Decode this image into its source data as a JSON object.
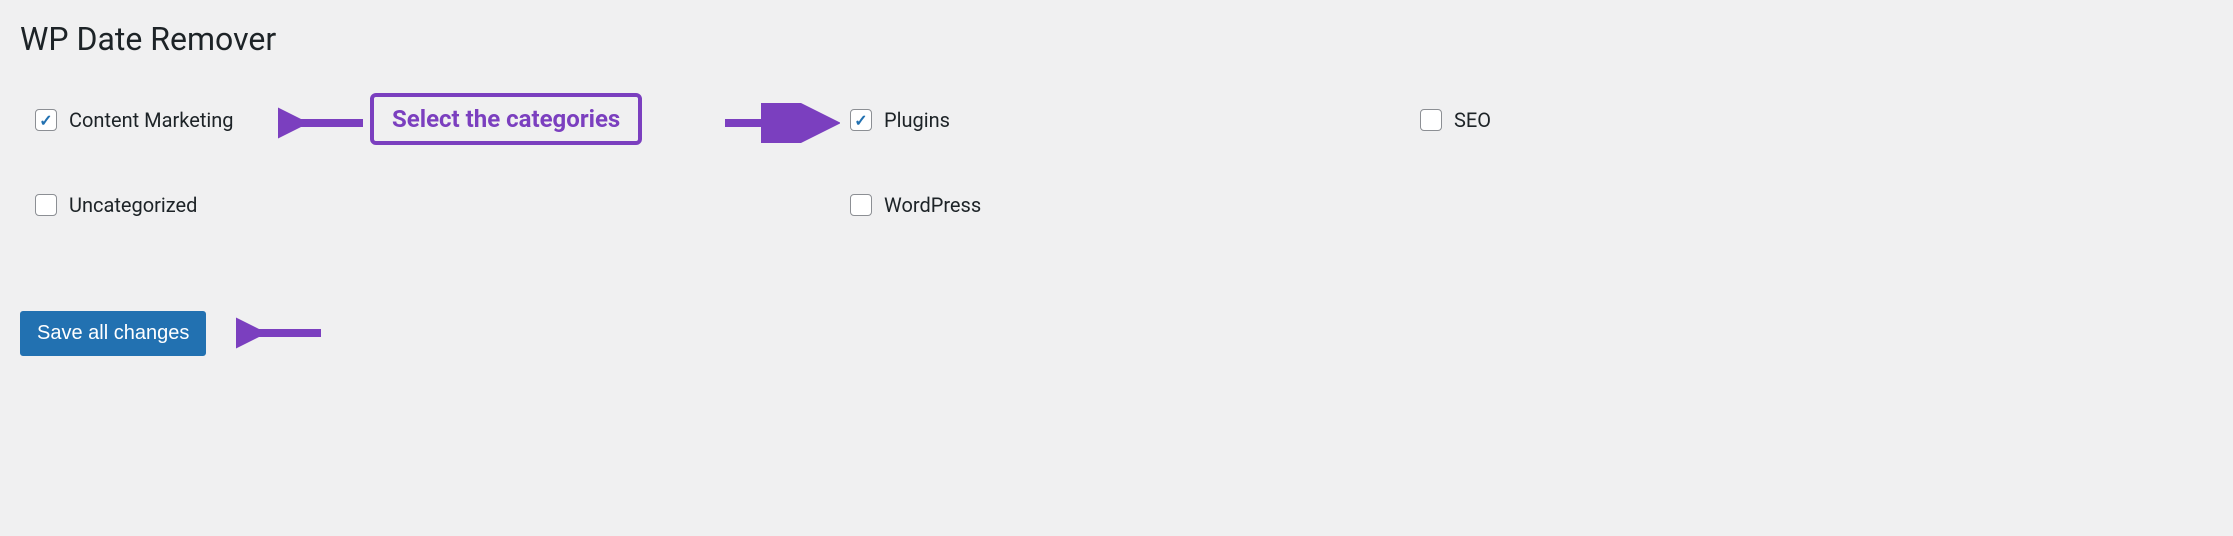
{
  "page_title": "WP Date Remover",
  "annotation": {
    "callout": "Select the categories"
  },
  "categories": [
    {
      "id": "content-marketing",
      "label": "Content Marketing",
      "checked": true
    },
    {
      "id": "plugins",
      "label": "Plugins",
      "checked": true
    },
    {
      "id": "seo",
      "label": "SEO",
      "checked": false
    },
    {
      "id": "uncategorized",
      "label": "Uncategorized",
      "checked": false
    },
    {
      "id": "wordpress",
      "label": "WordPress",
      "checked": false
    }
  ],
  "save_button_label": "Save all changes",
  "colors": {
    "annotation": "#7b3fbf",
    "button_bg": "#2271b1",
    "checkbox_check": "#2271b1"
  }
}
